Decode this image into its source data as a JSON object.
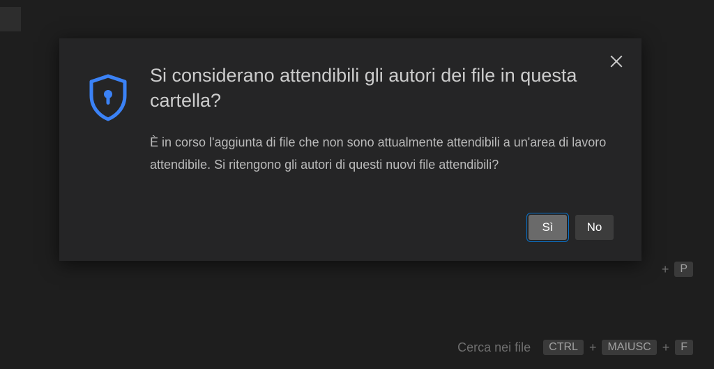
{
  "dialog": {
    "title": "Si considerano attendibili gli autori dei file in questa cartella?",
    "message": "È in corso l'aggiunta di file che non sono attualmente attendibili a un'area di lavoro attendibile. Si ritengono gli autori di questi nuovi file attendibili?",
    "yes_label": "Sì",
    "no_label": "No"
  },
  "hints": {
    "row1": {
      "key1": "P"
    },
    "row2": {
      "label": "Cerca nei file",
      "key1": "CTRL",
      "key2": "MAIUSC",
      "key3": "F"
    }
  },
  "icons": {
    "shield_color": "#3b82f6"
  }
}
